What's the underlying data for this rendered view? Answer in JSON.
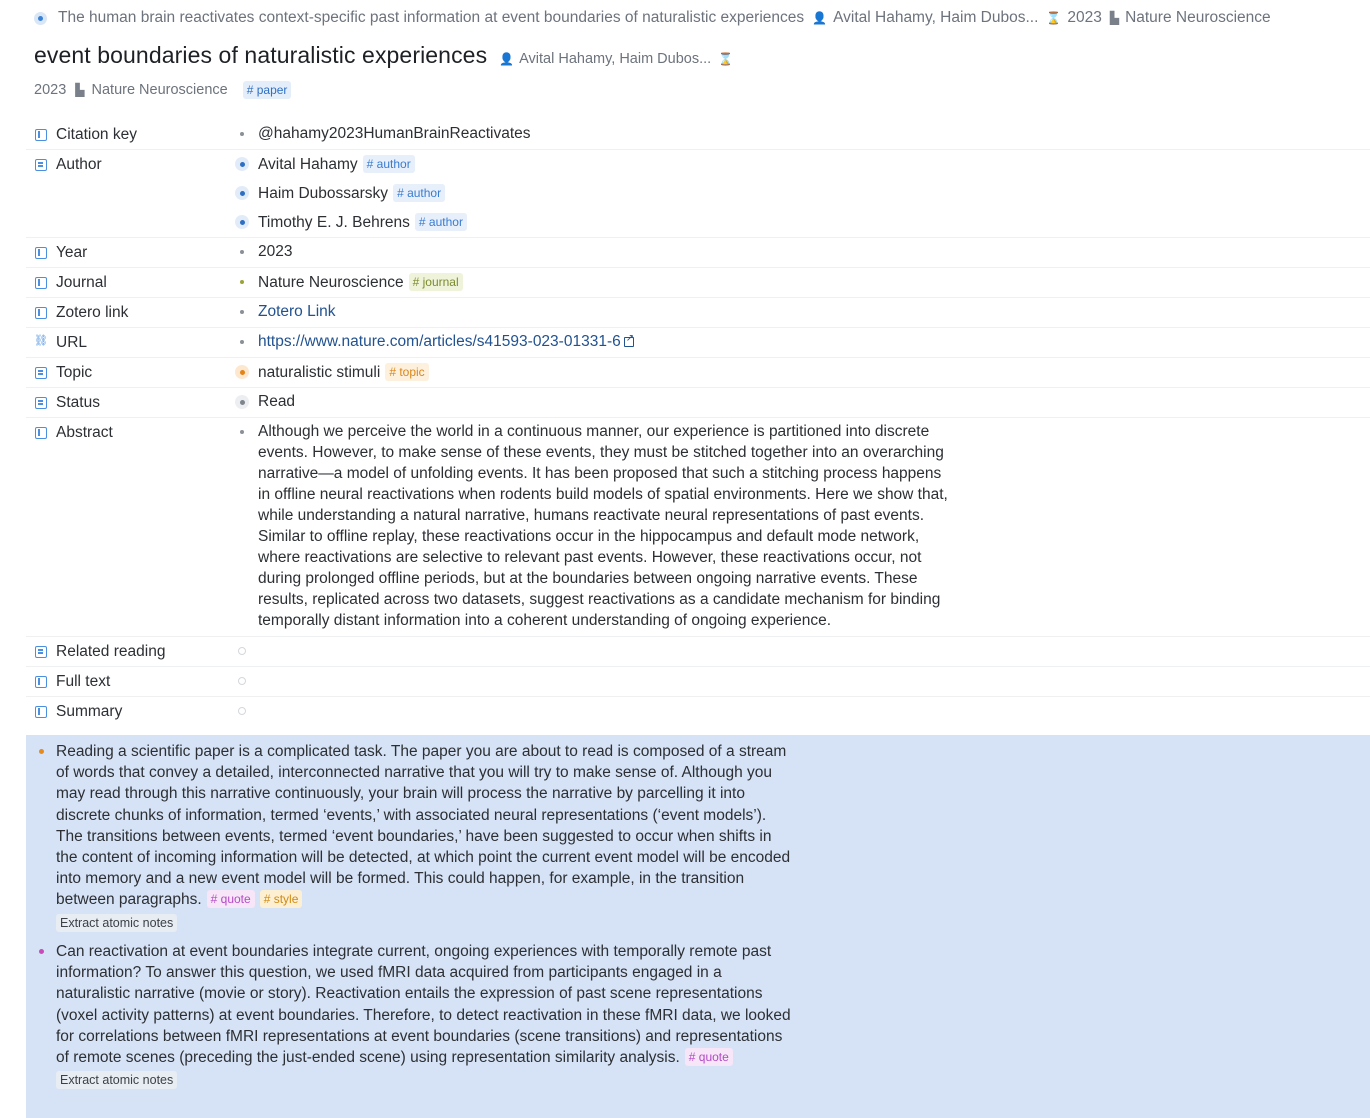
{
  "breadcrumb": {
    "text": "The human brain reactivates context-specific past information at event boundaries of naturalistic experiences",
    "authors": "Avital Hahamy, Haim Dubos...",
    "year": "2023",
    "journal": "Nature Neuroscience"
  },
  "header": {
    "title": "event boundaries of naturalistic experiences",
    "authors": "Avital Hahamy, Haim Dubos...",
    "year": "2023",
    "journal": "Nature Neuroscience",
    "tag": "# paper"
  },
  "fields": {
    "citation_key": {
      "label": "Citation key",
      "value": "@hahamy2023HumanBrainReactivates"
    },
    "author": {
      "label": "Author",
      "values": [
        {
          "name": "Avital Hahamy",
          "tag": "# author"
        },
        {
          "name": "Haim Dubossarsky",
          "tag": "# author"
        },
        {
          "name": "Timothy E. J. Behrens",
          "tag": "# author"
        }
      ]
    },
    "year": {
      "label": "Year",
      "value": "2023"
    },
    "journal": {
      "label": "Journal",
      "value": "Nature Neuroscience",
      "tag": "# journal"
    },
    "zotero": {
      "label": "Zotero link",
      "value": "Zotero Link"
    },
    "url": {
      "label": "URL",
      "value": "https://www.nature.com/articles/s41593-023-01331-6"
    },
    "topic": {
      "label": "Topic",
      "value": "naturalistic stimuli",
      "tag": "# topic"
    },
    "status": {
      "label": "Status",
      "value": "Read"
    },
    "abstract": {
      "label": "Abstract",
      "value": "Although we perceive the world in a continuous manner, our experience is partitioned into discrete events. However, to make sense of these events, they must be stitched together into an overarching narrative—a model of unfolding events. It has been proposed that such a stitching process happens in offline neural reactivations when rodents build models of spatial environments. Here we show that, while understanding a natural narrative, humans reactivate neural representations of past events. Similar to offline replay, these reactivations occur in the hippocampus and default mode network, where reactivations are selective to relevant past events. However, these reactivations occur, not during prolonged offline periods, but at the boundaries between ongoing narrative events. These results, replicated across two datasets, suggest reactivations as a candidate mechanism for binding temporally distant information into a coherent understanding of ongoing experience."
    },
    "related": {
      "label": "Related reading"
    },
    "fulltext": {
      "label": "Full text"
    },
    "summary": {
      "label": "Summary"
    }
  },
  "blocks": [
    {
      "text": "Reading a scientific paper is a complicated task. The paper you are about to read is composed of a stream of words that convey a detailed, interconnected narrative that you will try to make sense of. Although you may read through this narrative continuously, your brain will process the narrative by parcelling it into discrete chunks of information, termed ‘events,’ with associated neural representations (‘event models’). The transitions between events, termed ‘event boundaries,’ have been suggested to occur when shifts in the content of incoming information will be detected, at which point the current event model will be encoded into memory and a new event model will be formed. This could happen, for example, in the transition between paragraphs.",
      "tags": [
        "# quote",
        "# style"
      ],
      "button": "Extract atomic notes",
      "bullet_color": "#e58a1f"
    },
    {
      "text": "Can reactivation at event boundaries integrate current, ongoing experiences with temporally remote past information? To answer this question, we used fMRI data acquired from participants engaged in a naturalistic narrative (movie or story). Reactivation entails the expression of past scene representations (voxel activity patterns) at event boundaries. Therefore, to detect reactivation in these fMRI data, we looked for correlations between fMRI representations at event boundaries (scene transitions) and representations of remote scenes (preceding the just-ended scene) using representation similarity analysis.",
      "tags": [
        "# quote"
      ],
      "button": "Extract atomic notes",
      "bullet_color": "#c94ab8"
    }
  ]
}
